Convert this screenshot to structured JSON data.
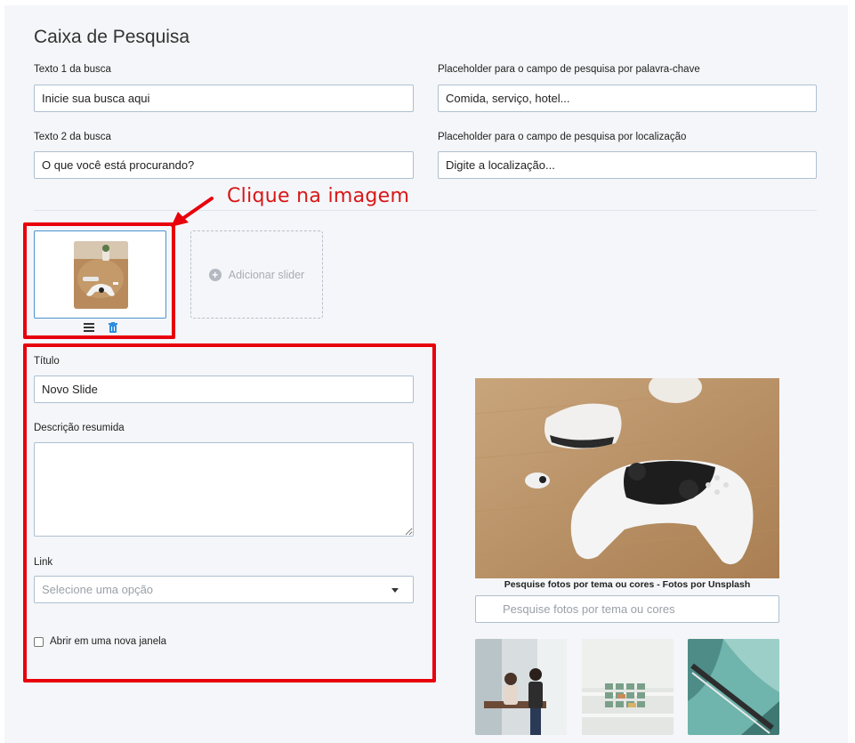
{
  "section_title": "Caixa de Pesquisa",
  "search": {
    "text1_label": "Texto 1 da busca",
    "text1_value": "Inicie sua busca aqui",
    "keyword_placeholder_label": "Placeholder para o campo de pesquisa por palavra-chave",
    "keyword_placeholder_value": "Comida, serviço, hotel...",
    "text2_label": "Texto 2 da busca",
    "text2_value": "O que você está procurando?",
    "location_placeholder_label": "Placeholder para o campo de pesquisa por localização",
    "location_placeholder_value": "Digite a localização..."
  },
  "annotation": {
    "text": "Clique na imagem",
    "color": "#e8000b"
  },
  "slider": {
    "add_label": "Adicionar slider",
    "menu_icon": "hamburger-menu-icon",
    "delete_icon": "trash-icon"
  },
  "slide_form": {
    "title_label": "Título",
    "title_value": "Novo Slide",
    "description_label": "Descrição resumida",
    "description_value": "",
    "link_label": "Link",
    "link_placeholder": "Selecione uma opção",
    "new_window_label": "Abrir em uma nova janela",
    "new_window_checked": false
  },
  "unsplash": {
    "caption": "Pesquise fotos por tema ou cores - Fotos por Unsplash",
    "search_placeholder": "Pesquise fotos por tema ou cores"
  },
  "colors": {
    "accent_blue": "#4a93cf",
    "annotation_red": "#e8000b",
    "delete_blue": "#2f8ee0"
  }
}
